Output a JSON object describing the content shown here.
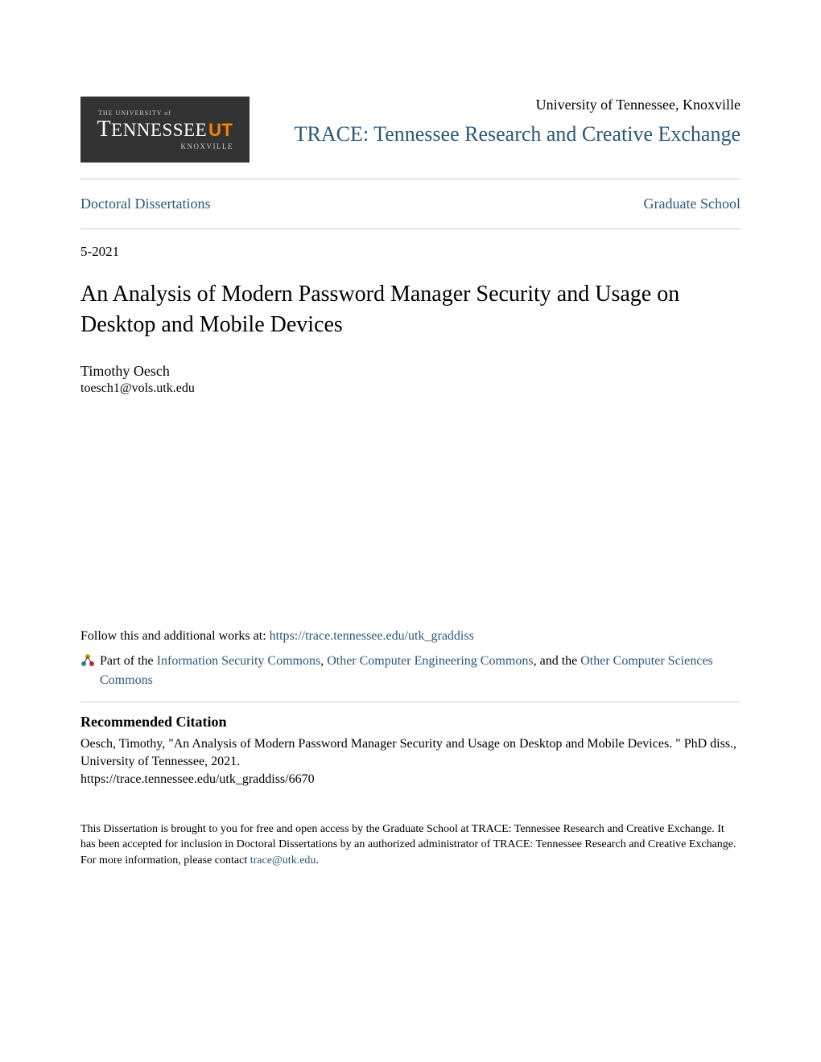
{
  "logo": {
    "line1": "THE UNIVERSITY of",
    "line2a": "T",
    "line2b": "ENNESSEE",
    "ut_mark": "UT",
    "line3": "KNOXVILLE"
  },
  "header": {
    "university": "University of Tennessee, Knoxville",
    "repository_title": "TRACE: Tennessee Research and Creative Exchange"
  },
  "nav": {
    "left_link": "Doctoral Dissertations",
    "right_link": "Graduate School"
  },
  "date": "5-2021",
  "title": "An Analysis of Modern Password Manager Security and Usage on Desktop and Mobile Devices",
  "author": {
    "name": "Timothy Oesch",
    "email": "toesch1@vols.utk.edu"
  },
  "follow": {
    "prefix": "Follow this and additional works at: ",
    "url": "https://trace.tennessee.edu/utk_graddiss"
  },
  "partof": {
    "prefix": "Part of the ",
    "link1": "Information Security Commons",
    "sep1": ", ",
    "link2": "Other Computer Engineering Commons",
    "sep2": ", and the ",
    "link3": "Other Computer Sciences Commons"
  },
  "citation": {
    "heading": "Recommended Citation",
    "text": "Oesch, Timothy, \"An Analysis of Modern Password Manager Security and Usage on Desktop and Mobile Devices. \" PhD diss., University of Tennessee, 2021.",
    "url": "https://trace.tennessee.edu/utk_graddiss/6670"
  },
  "footer": {
    "text": "This Dissertation is brought to you for free and open access by the Graduate School at TRACE: Tennessee Research and Creative Exchange. It has been accepted for inclusion in Doctoral Dissertations by an authorized administrator of TRACE: Tennessee Research and Creative Exchange. For more information, please contact ",
    "contact": "trace@utk.edu",
    "period": "."
  }
}
